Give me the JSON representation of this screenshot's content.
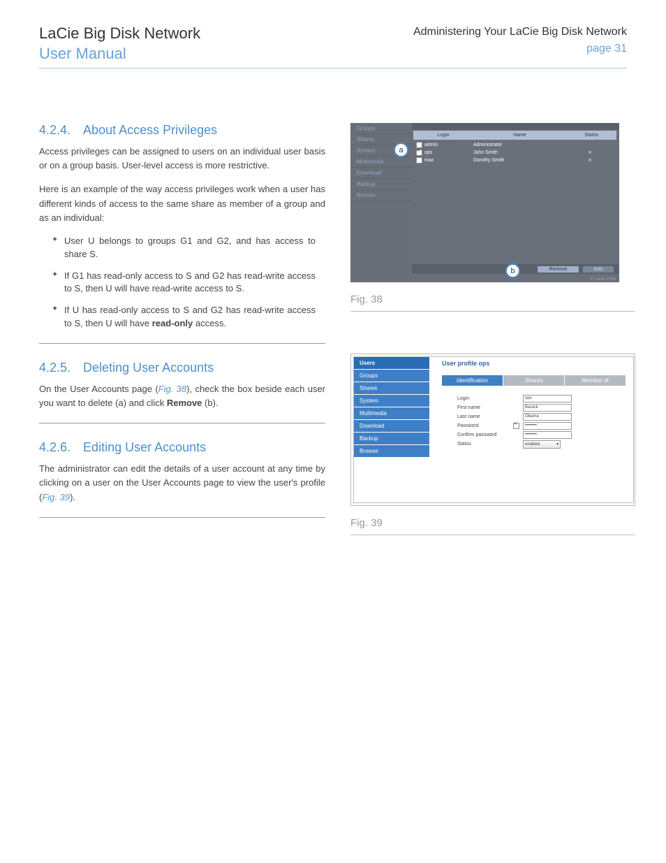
{
  "header": {
    "title": "LaCie Big Disk Network",
    "subtitle": "User Manual",
    "section": "Administering Your LaCie Big Disk Network",
    "page": "page 31"
  },
  "sec424": {
    "num": "4.2.4.",
    "title": "About Access Privileges",
    "p1": "Access privileges can be assigned to users on an individual user basis or on a group basis. User-level access is more restrictive.",
    "p2": "Here is an example of the way access privileges work when a user has different kinds of access to the same share as member of a group and as an individual:",
    "b1": "User U belongs to groups G1 and G2, and  has access to share S.",
    "b2": "If G1 has read-only access to S and G2 has read-write access to S, then U will have read-write access to S.",
    "b3a": "If U has read-only access to S and G2 has read-write access to S, then U will have ",
    "b3b": "read-only",
    "b3c": " access."
  },
  "sec425": {
    "num": "4.2.5.",
    "title": "Deleting User Accounts",
    "p1a": "On the User Accounts page (",
    "p1link": "Fig. 38",
    "p1b": "), check the box beside each user you want to delete (a) and click ",
    "p1c": "Remove",
    "p1d": " (b)."
  },
  "sec426": {
    "num": "4.2.6.",
    "title": "Editing User Accounts",
    "p1a": "The administrator can edit the details of a user account at any time by clicking on a user on the User Accounts page to view the user's profile (",
    "p1link": "Fig. 39",
    "p1b": ")."
  },
  "fig38": {
    "caption": "Fig. 38",
    "side": [
      "Groups",
      "Shares",
      "System",
      "Multimedia",
      "Download",
      "Backup",
      "Browse"
    ],
    "thead": {
      "c1": "Login",
      "c2": "Name",
      "c3": "Status"
    },
    "rows": [
      {
        "chk": false,
        "login": "admin",
        "name": "Administrator",
        "status": ""
      },
      {
        "chk": true,
        "login": "ops",
        "name": "John Smith",
        "status": "■"
      },
      {
        "chk": false,
        "login": "max",
        "name": "Dorothy Smith",
        "status": "■"
      }
    ],
    "btn_remove": "Remove",
    "btn_add": "Add",
    "callout_a": "a",
    "callout_b": "b",
    "copyright": "© LaCie 2008"
  },
  "fig39": {
    "caption": "Fig. 39",
    "side": [
      "Users",
      "Groups",
      "Shares",
      "System",
      "Multimedia",
      "Download",
      "Backup",
      "Browse"
    ],
    "mtitle": "User profile ops",
    "tabs": [
      "Identification",
      "Shares",
      "Member of"
    ],
    "form": {
      "login_lbl": "Login",
      "login_val": "ops",
      "first_lbl": "First name",
      "first_val": "Barack",
      "last_lbl": "Last name",
      "last_val": "Obama",
      "pass_lbl": "Password",
      "pass_val": "••••••••",
      "conf_lbl": "Confirm password",
      "conf_val": "••••••••",
      "stat_lbl": "Status",
      "stat_val": "enabled"
    }
  }
}
